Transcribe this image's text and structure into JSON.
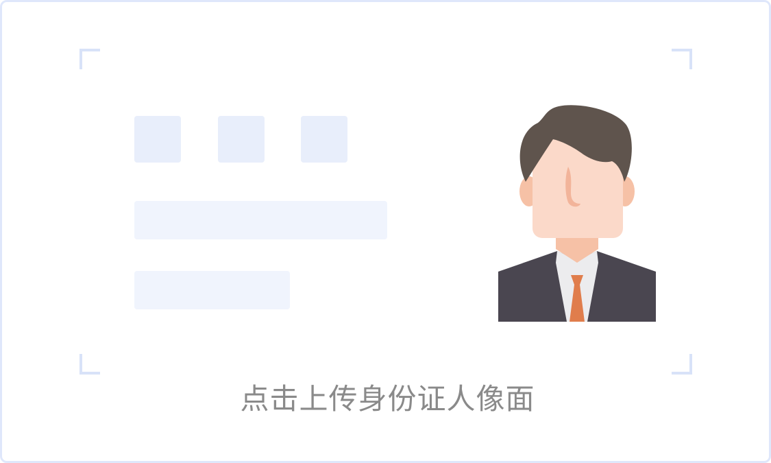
{
  "upload_card": {
    "caption": "点击上传身份证人像面"
  },
  "colors": {
    "card_border": "#dfe7fb",
    "corner_mark": "#d8e2f8",
    "placeholder_square": "#e8eefb",
    "placeholder_line": "#f0f4fd",
    "caption_text": "#8a8a8a",
    "hair": "#5f544d",
    "skin": "#fbd9c9",
    "suit": "#4a4650",
    "tie": "#e07d4c"
  },
  "icons": {
    "portrait": "person-avatar-icon"
  }
}
